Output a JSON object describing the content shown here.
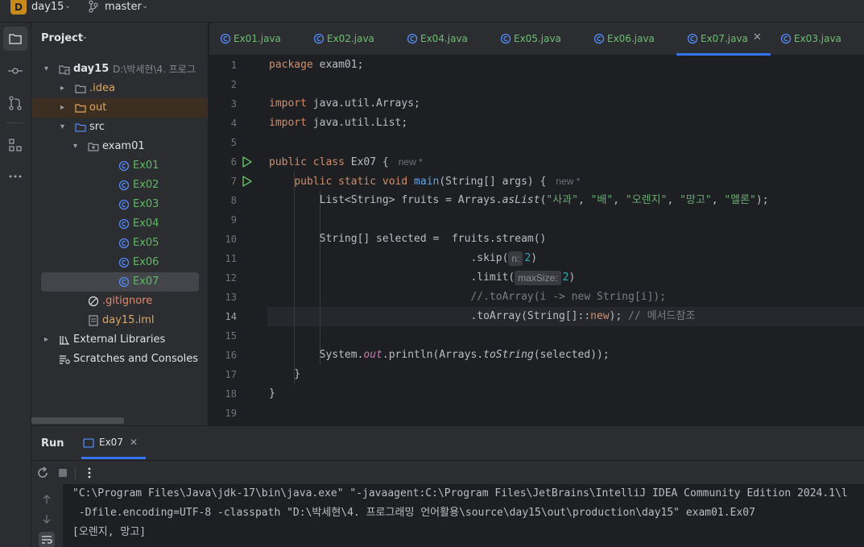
{
  "titlebar": {
    "project_badge": "D",
    "project_name": "day15",
    "branch": "master"
  },
  "activity": {
    "items": [
      "project-icon",
      "commit-icon",
      "pull-requests-icon",
      "structure-icon",
      "more-icon"
    ]
  },
  "project_panel": {
    "header": "Project",
    "tree": [
      {
        "label": "day15",
        "extra": "D:\\박세현\\4. 프로그",
        "level": 0,
        "arrow": "▾",
        "icon": "module-folder-icon",
        "style": "default",
        "bold": true
      },
      {
        "label": ".idea",
        "level": 1,
        "arrow": "▸",
        "icon": "folder-icon",
        "style": "out"
      },
      {
        "label": "out",
        "level": 1,
        "arrow": "▸",
        "icon": "folder-excluded-icon",
        "style": "out"
      },
      {
        "label": "src",
        "level": 1,
        "arrow": "▾",
        "icon": "source-folder-icon",
        "style": "default"
      },
      {
        "label": "exam01",
        "level": 2,
        "arrow": "▾",
        "icon": "package-icon",
        "style": "default"
      },
      {
        "label": "Ex01",
        "level": 3,
        "icon": "java-class-icon",
        "style": "green"
      },
      {
        "label": "Ex02",
        "level": 3,
        "icon": "java-class-icon",
        "style": "green"
      },
      {
        "label": "Ex03",
        "level": 3,
        "icon": "java-class-icon",
        "style": "green"
      },
      {
        "label": "Ex04",
        "level": 3,
        "icon": "java-class-icon",
        "style": "green"
      },
      {
        "label": "Ex05",
        "level": 3,
        "icon": "java-class-icon",
        "style": "green"
      },
      {
        "label": "Ex06",
        "level": 3,
        "icon": "java-class-icon",
        "style": "green"
      },
      {
        "label": "Ex07",
        "level": 3,
        "icon": "java-class-icon",
        "style": "green",
        "selected": true
      },
      {
        "label": ".gitignore",
        "level": 2,
        "icon": "ignore-file-icon",
        "style": "git"
      },
      {
        "label": "day15.iml",
        "level": 2,
        "icon": "iml-file-icon",
        "style": "out"
      },
      {
        "label": "External Libraries",
        "level": 0,
        "arrow": "▸",
        "icon": "libraries-icon",
        "style": "default"
      },
      {
        "label": "Scratches and Consoles",
        "level": 0,
        "icon": "scratches-icon",
        "style": "default"
      }
    ]
  },
  "tabs": [
    {
      "label": "Ex01.java",
      "active": false
    },
    {
      "label": "Ex02.java",
      "active": false
    },
    {
      "label": "Ex04.java",
      "active": false
    },
    {
      "label": "Ex05.java",
      "active": false
    },
    {
      "label": "Ex06.java",
      "active": false
    },
    {
      "label": "Ex07.java",
      "active": true
    },
    {
      "label": "Ex03.java",
      "active": false
    }
  ],
  "editor": {
    "current_line": 14,
    "lines": [
      [
        {
          "t": "package",
          "c": "kw"
        },
        {
          "t": " exam01;"
        }
      ],
      [],
      [
        {
          "t": "import",
          "c": "kw"
        },
        {
          "t": " java.util.Arrays;"
        }
      ],
      [
        {
          "t": "import",
          "c": "kw"
        },
        {
          "t": " java.util.List;"
        }
      ],
      [],
      [
        {
          "t": "public",
          "c": "kw"
        },
        {
          "t": " "
        },
        {
          "t": "class",
          "c": "kw"
        },
        {
          "t": " Ex07 {"
        },
        {
          "t": "new *",
          "c": "meta"
        }
      ],
      [
        {
          "t": "    "
        },
        {
          "t": "public",
          "c": "kw"
        },
        {
          "t": " "
        },
        {
          "t": "static",
          "c": "kw"
        },
        {
          "t": " "
        },
        {
          "t": "void",
          "c": "kw"
        },
        {
          "t": " "
        },
        {
          "t": "main",
          "c": "fn"
        },
        {
          "t": "(String[] args) {"
        },
        {
          "t": "new *",
          "c": "meta"
        }
      ],
      [
        {
          "t": "        List<String> fruits = Arrays."
        },
        {
          "t": "asList",
          "c": "ital"
        },
        {
          "t": "("
        },
        {
          "t": "\"사과\"",
          "c": "str"
        },
        {
          "t": ", "
        },
        {
          "t": "\"배\"",
          "c": "str"
        },
        {
          "t": ", "
        },
        {
          "t": "\"오렌지\"",
          "c": "str"
        },
        {
          "t": ", "
        },
        {
          "t": "\"망고\"",
          "c": "str"
        },
        {
          "t": ", "
        },
        {
          "t": "\"멜론\"",
          "c": "str"
        },
        {
          "t": ");"
        }
      ],
      [],
      [
        {
          "t": "        String[] selected =  fruits.stream()"
        }
      ],
      [
        {
          "t": "                                .skip("
        },
        {
          "t": "n:",
          "c": "hint"
        },
        {
          "t": "2",
          "c": "num"
        },
        {
          "t": ")"
        }
      ],
      [
        {
          "t": "                                .limit("
        },
        {
          "t": "maxSize:",
          "c": "hint"
        },
        {
          "t": "2",
          "c": "num"
        },
        {
          "t": ")"
        }
      ],
      [
        {
          "t": "                                //.toArray(i -> new String[i]);",
          "c": "cmt"
        }
      ],
      [
        {
          "t": "                                .toArray(String[]::"
        },
        {
          "t": "new",
          "c": "kw"
        },
        {
          "t": "); "
        },
        {
          "t": "// 메서드참조",
          "c": "cmt"
        }
      ],
      [],
      [
        {
          "t": "        System."
        },
        {
          "t": "out",
          "c": "stat"
        },
        {
          "t": ".println(Arrays."
        },
        {
          "t": "toString",
          "c": "ital"
        },
        {
          "t": "(selected));"
        }
      ],
      [
        {
          "t": "    }"
        }
      ],
      [
        {
          "t": "}"
        }
      ],
      []
    ],
    "run_gutter_lines": [
      6,
      7
    ]
  },
  "run_panel": {
    "title": "Run",
    "tab_label": "Ex07",
    "console_lines": [
      "\"C:\\Program Files\\Java\\jdk-17\\bin\\java.exe\" \"-javaagent:C:\\Program Files\\JetBrains\\IntelliJ IDEA Community Edition 2024.1\\l",
      " -Dfile.encoding=UTF-8 -classpath \"D:\\박세현\\4. 프로그래밍 언어활용\\source\\day15\\out\\production\\day15\" exam01.Ex07",
      "[오렌지, 망고]"
    ]
  }
}
